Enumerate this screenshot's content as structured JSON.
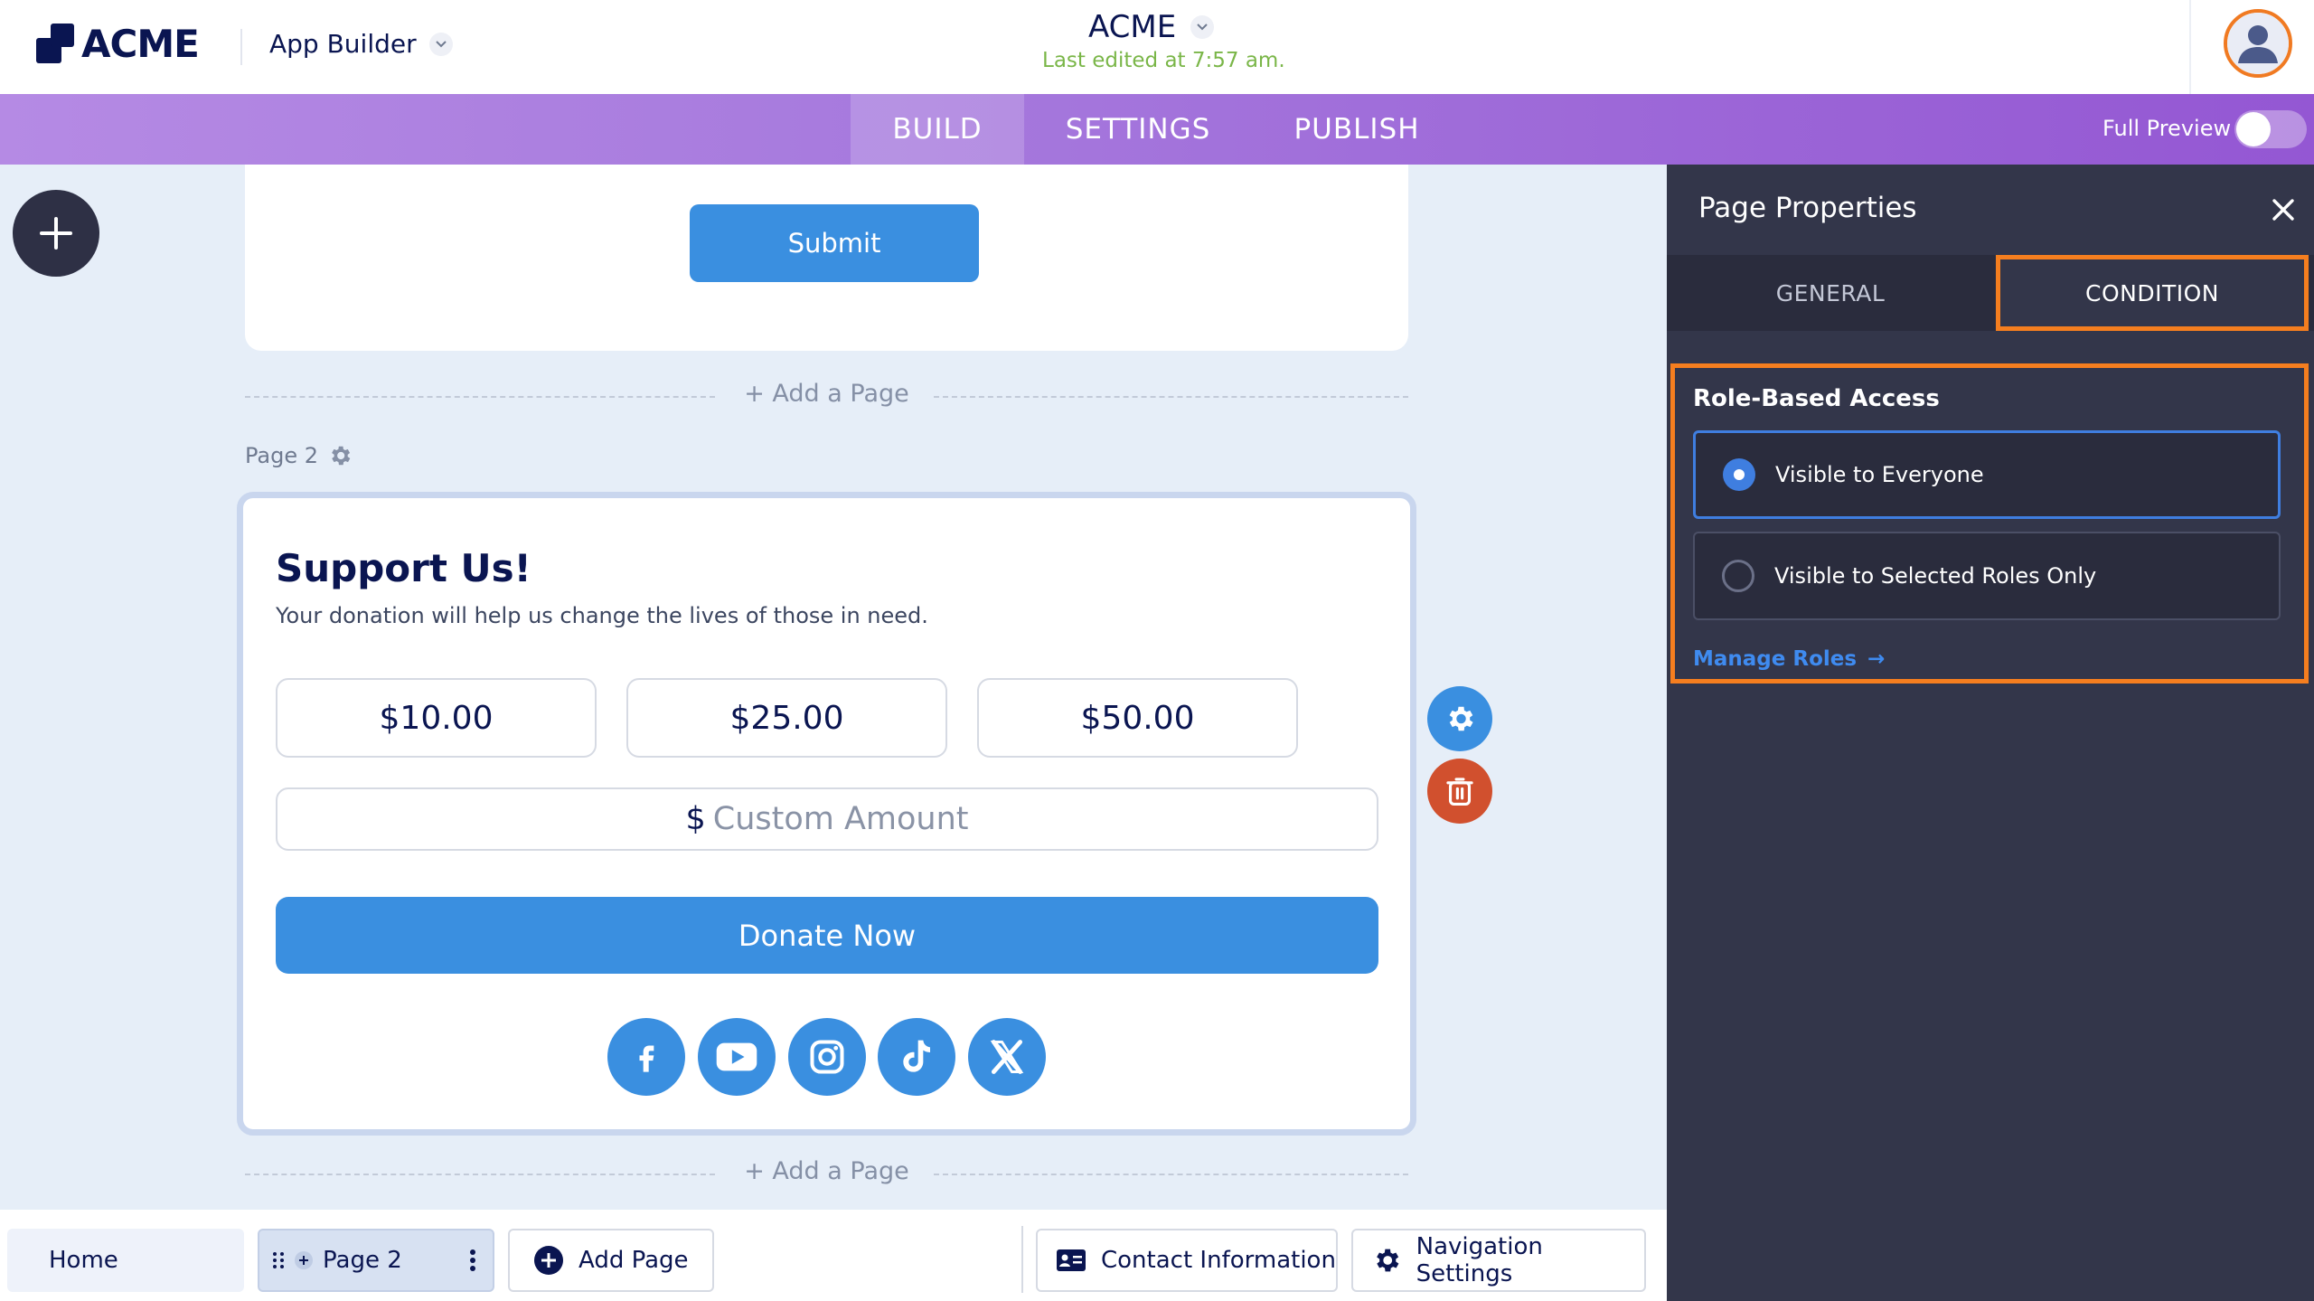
{
  "header": {
    "logo_text": "ACME",
    "app_switcher_label": "App Builder",
    "doc_title": "ACME",
    "last_edited": "Last edited at 7:57 am."
  },
  "nav": {
    "tabs": [
      {
        "label": "BUILD",
        "active": true
      },
      {
        "label": "SETTINGS",
        "active": false
      },
      {
        "label": "PUBLISH",
        "active": false
      }
    ],
    "full_preview_label": "Full Preview",
    "full_preview_on": false
  },
  "canvas": {
    "submit_label": "Submit",
    "add_page_label": "+ Add a Page",
    "page2_label": "Page 2",
    "support_title": "Support Us!",
    "support_subtitle": "Your donation will help us change the lives of those in need.",
    "amounts": [
      "$10.00",
      "$25.00",
      "$50.00"
    ],
    "currency_symbol": "$",
    "custom_amount_placeholder": "Custom Amount",
    "donate_label": "Donate Now",
    "social_icons": [
      "facebook-icon",
      "youtube-icon",
      "instagram-icon",
      "tiktok-icon",
      "x-icon"
    ]
  },
  "bottom_bar": {
    "home_label": "Home",
    "page2_label": "Page 2",
    "add_page_label": "Add Page",
    "contact_label": "Contact Information",
    "nav_settings_label": "Navigation Settings"
  },
  "panel": {
    "title": "Page Properties",
    "tabs": [
      {
        "label": "GENERAL",
        "active": false
      },
      {
        "label": "CONDITION",
        "active": true
      }
    ],
    "section_title": "Role-Based Access",
    "options": [
      {
        "label": "Visible to Everyone",
        "selected": true
      },
      {
        "label": "Visible to Selected Roles Only",
        "selected": false
      }
    ],
    "manage_roles_label": "Manage Roles",
    "manage_roles_arrow": "→"
  },
  "colors": {
    "brand_navy": "#0a1551",
    "primary_blue": "#3a8fe0",
    "highlight_orange": "#f57e1f",
    "panel_bg": "#33364a",
    "edited_green": "#7ab648",
    "delete_red": "#d1502e"
  }
}
